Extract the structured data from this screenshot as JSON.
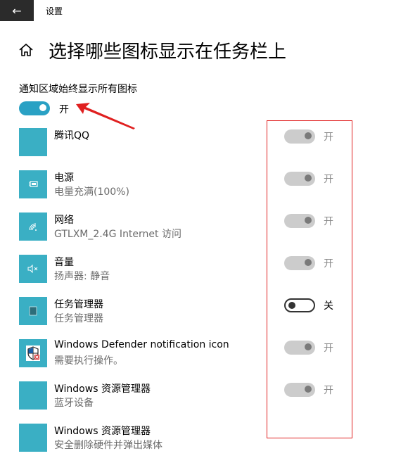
{
  "window": {
    "title": "设置",
    "back_icon": "←"
  },
  "page": {
    "title": "选择哪些图标显示在任务栏上"
  },
  "master": {
    "label": "通知区域始终显示所有图标",
    "state_label": "开",
    "on": true
  },
  "colors": {
    "accent": "#2aa1c4",
    "tile": "#3aafc4",
    "annotation": "#e02020"
  },
  "apps": [
    {
      "name": "腾讯QQ",
      "sub": "",
      "icon": "qq-icon",
      "state_label": "开",
      "on": true
    },
    {
      "name": "电源",
      "sub": "电量充满(100%)",
      "icon": "battery-icon",
      "state_label": "开",
      "on": true
    },
    {
      "name": "网络",
      "sub": "GTLXM_2.4G Internet 访问",
      "icon": "wifi-icon",
      "state_label": "开",
      "on": true
    },
    {
      "name": "音量",
      "sub": "扬声器: 静音",
      "icon": "volume-muted-icon",
      "state_label": "开",
      "on": true
    },
    {
      "name": "任务管理器",
      "sub": "任务管理器",
      "icon": "task-manager-icon",
      "state_label": "关",
      "on": false
    },
    {
      "name": "Windows Defender notification icon",
      "sub": "需要执行操作。",
      "icon": "defender-shield-icon",
      "state_label": "开",
      "on": true
    },
    {
      "name": "Windows 资源管理器",
      "sub": "蓝牙设备",
      "icon": "explorer-icon",
      "state_label": "开",
      "on": true
    },
    {
      "name": "Windows 资源管理器",
      "sub": "安全删除硬件并弹出媒体",
      "icon": "explorer-icon",
      "state_label": "",
      "on": true
    }
  ]
}
